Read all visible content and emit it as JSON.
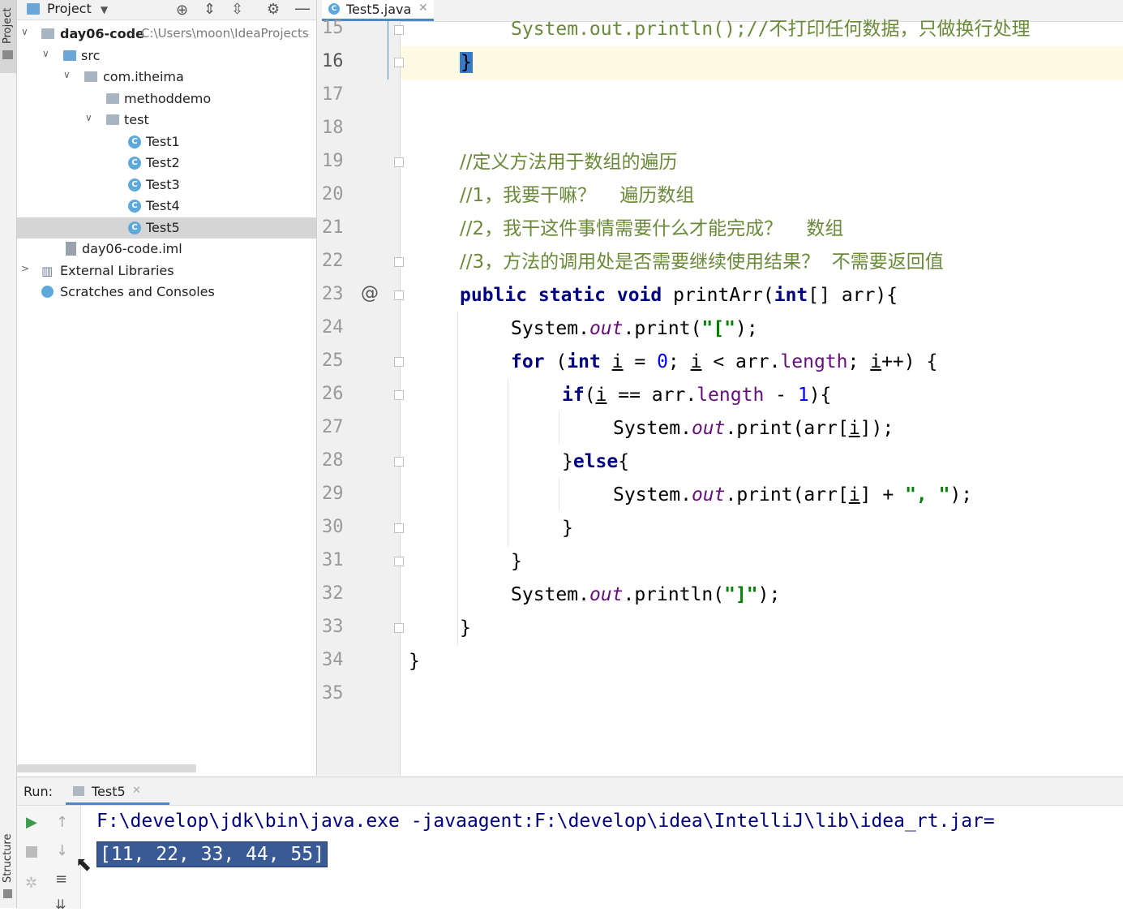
{
  "side_tabs": {
    "project": "Project",
    "structure": "Structure"
  },
  "project_panel": {
    "title": "Project",
    "tree": [
      {
        "label": "day06-code",
        "path": "C:\\Users\\moon\\IdeaProjects",
        "type": "module"
      },
      {
        "label": "src",
        "type": "src-folder"
      },
      {
        "label": "com.itheima",
        "type": "package"
      },
      {
        "label": "methoddemo",
        "type": "package"
      },
      {
        "label": "test",
        "type": "package"
      },
      {
        "label": "Test1",
        "type": "class"
      },
      {
        "label": "Test2",
        "type": "class"
      },
      {
        "label": "Test3",
        "type": "class"
      },
      {
        "label": "Test4",
        "type": "class"
      },
      {
        "label": "Test5",
        "type": "class",
        "selected": true
      },
      {
        "label": "day06-code.iml",
        "type": "iml"
      },
      {
        "label": "External Libraries",
        "type": "libraries"
      },
      {
        "label": "Scratches and Consoles",
        "type": "scratches"
      }
    ]
  },
  "editor": {
    "tab_label": "Test5.java",
    "line_numbers": [
      "15",
      "16",
      "17",
      "18",
      "19",
      "20",
      "21",
      "22",
      "23",
      "24",
      "25",
      "26",
      "27",
      "28",
      "29",
      "30",
      "31",
      "32",
      "33",
      "34",
      "35"
    ],
    "gutter_marker": "@",
    "comments": [
      "//定义方法用于数组的遍历",
      "//1，我要干嘛？    遍历数组",
      "//2，我干这件事情需要什么才能完成？    数组",
      "//3，方法的调用处是否需要继续使用结果？  不需要返回值"
    ],
    "line15_text": "System.out.println();//不打印任何数据，只做换行处理"
  },
  "run_panel": {
    "label": "Run:",
    "tab_label": "Test5",
    "output": [
      "F:\\develop\\jdk\\bin\\java.exe -javaagent:F:\\develop\\idea\\IntelliJ\\lib\\idea_rt.jar=",
      "[11, 22, 33, 44, 55]"
    ]
  },
  "colors": {
    "keyword": "#000080",
    "comment": "#6a8a3a",
    "field": "#660e7a",
    "string": "#008000",
    "number": "#0000ff",
    "selection": "#3a5a96",
    "caret_line": "#fffae3"
  }
}
